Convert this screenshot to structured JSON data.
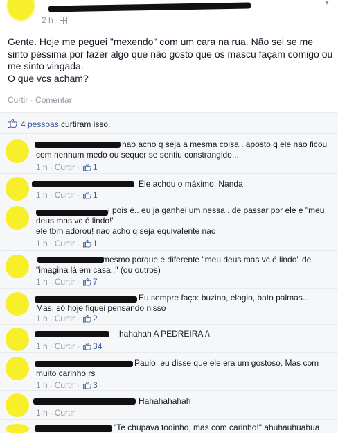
{
  "post": {
    "time": "2 h",
    "text_lines": [
      "Gente. Hoje me peguei \"mexendo\" com um cara na rua. Não sei se me",
      "sinto péssima por fazer algo que não gosto que os mascu façam comigo ou",
      "me sinto vingada.",
      "O que vcs acham?"
    ],
    "actions": {
      "like": "Curtir",
      "sep": "·",
      "comment": "Comentar"
    }
  },
  "likes": {
    "count_link": "4 pessoas",
    "suffix": "curtiram isso."
  },
  "comments": [
    {
      "lines": [
        "nao acho q seja a mesma coisa.. aposto q ele nao ficou",
        "com nenhum medo ou sequer se sentiu constrangido..."
      ],
      "time": "1 h",
      "like": "Curtir",
      "likes": "1"
    },
    {
      "lines": [
        "Ele achou o máximo, Nanda"
      ],
      "time": "1 h",
      "like": "Curtir",
      "likes": "1"
    },
    {
      "lines": [
        "i pois é.. eu ja ganhei um nessa.. de passar por ele e \"meu",
        "deus mas vc é lindo!\"",
        "ele tbm adorou! nao acho q seja equivalente nao"
      ],
      "time": "1 h",
      "like": "Curtir",
      "likes": "1"
    },
    {
      "lines": [
        "mesmo porque é diferente \"meu deus mas vc é lindo\" de",
        "\"imagina lá em casa..\" (ou outros)"
      ],
      "time": "1 h",
      "like": "Curtir",
      "likes": "7"
    },
    {
      "lines": [
        "Eu sempre faço: buzino, elogio, bato palmas..",
        "Mas, só hoje fiquei pensando nisso"
      ],
      "time": "1 h",
      "like": "Curtir",
      "likes": "2"
    },
    {
      "lines": [
        "hahahah A PEDREIRA /\\"
      ],
      "time": "1 h",
      "like": "Curtir",
      "likes": "34"
    },
    {
      "lines": [
        "Paulo, eu disse que ele era um gostoso. Mas com",
        "muito carinho rs"
      ],
      "time": "1 h",
      "like": "Curtir",
      "likes": "3"
    },
    {
      "lines": [
        "Hahahahahah"
      ],
      "time": "1 h",
      "like": "Curtir",
      "likes": ""
    },
    {
      "lines": [
        "\"Te chupava todinho, mas com carinho!\" ahuhauhuahua"
      ],
      "time": "",
      "like": "",
      "likes": ""
    }
  ],
  "colors": {
    "link": "#3b5998",
    "meta": "#9197a3",
    "background": "#f6f7f8",
    "censor": "#111111",
    "avatar_blur": "#f6ef2a"
  }
}
